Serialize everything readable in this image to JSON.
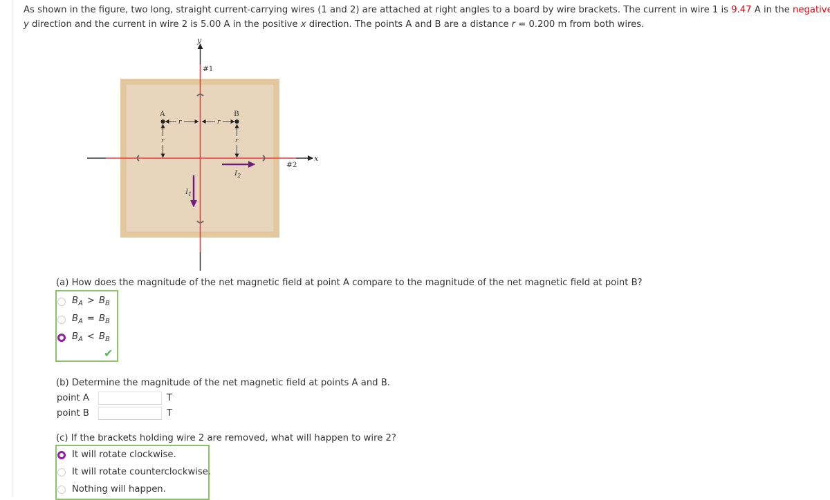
{
  "intro": {
    "p1": "As shown in the figure, two long, straight current-carrying wires (1 and 2) are attached at right angles to a board by wire brackets. The current in wire 1 is ",
    "current1": "9.47",
    "p2": " A in the ",
    "direction1": "negative",
    "p3": " ",
    "axis1": "y",
    "p4": " direction and the current in wire 2 is 5.00 A in the positive ",
    "axis2": "x",
    "p5": " direction. The points A and B are a distance ",
    "rvar": "r",
    "p6": " = 0.200 m  from both wires."
  },
  "figure": {
    "y_axis_label": "y",
    "x_axis_label": "x",
    "wire1_label": "#1",
    "wire2_label": "#2",
    "point_a_label": "A",
    "point_b_label": "B",
    "distance_label": "r",
    "current1_label": "I",
    "current1_sub": "1",
    "current2_label": "I",
    "current2_sub": "2",
    "colors": {
      "wire": "#f0363c",
      "board": "#e8d6bc",
      "board_border": "#e3c79e",
      "current_arrow": "#6e1e7a"
    }
  },
  "part_a": {
    "question": "(a) How does the magnitude of the net magnetic field at point A compare to the magnitude of the net magnetic field at point B?",
    "options": [
      {
        "lhs": "B",
        "lhs_sub": "A",
        "rel": ">",
        "rhs": "B",
        "rhs_sub": "B",
        "selected": false
      },
      {
        "lhs": "B",
        "lhs_sub": "A",
        "rel": "=",
        "rhs": "B",
        "rhs_sub": "B",
        "selected": false
      },
      {
        "lhs": "B",
        "lhs_sub": "A",
        "rel": "<",
        "rhs": "B",
        "rhs_sub": "B",
        "selected": true
      }
    ],
    "status": "correct"
  },
  "part_b": {
    "question": "(b) Determine the magnitude of the net magnetic field at points A and B.",
    "fields": [
      {
        "label": "point A",
        "value": "",
        "unit": "T"
      },
      {
        "label": "point B",
        "value": "",
        "unit": "T"
      }
    ]
  },
  "part_c": {
    "question": "(c) If the brackets holding wire 2 are removed, what will happen to wire 2?",
    "options": [
      {
        "label": "It will rotate clockwise.",
        "selected": true
      },
      {
        "label": "It will rotate counterclockwise.",
        "selected": false
      },
      {
        "label": "Nothing will happen.",
        "selected": false
      }
    ]
  }
}
